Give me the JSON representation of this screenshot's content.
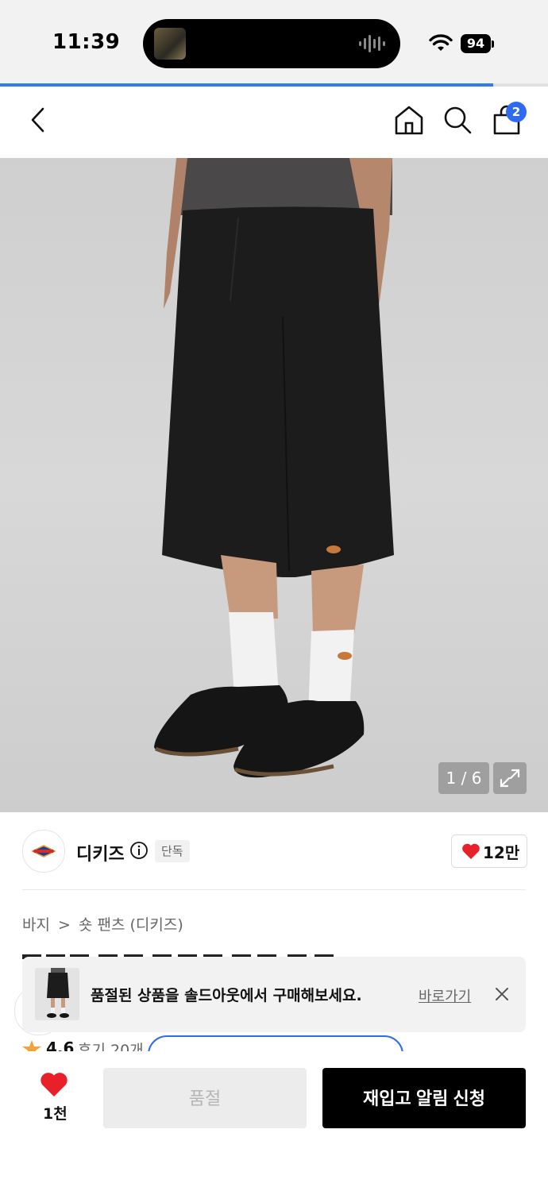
{
  "status_bar": {
    "time": "11:39",
    "battery": "94"
  },
  "page_progress": 0.9,
  "nav": {
    "back_icon": "chevron-left-icon",
    "home_icon": "home-icon",
    "search_icon": "search-icon",
    "cart_icon": "bag-icon",
    "cart_count": "2"
  },
  "gallery": {
    "counter": "1 / 6",
    "expand_icon": "expand-icon"
  },
  "brand": {
    "name": "디키즈",
    "badge": "단독",
    "like_count": "12만"
  },
  "breadcrumb": {
    "category": "바지",
    "separator": ">",
    "subcategory": "숏 팬츠 (디키즈)"
  },
  "toast": {
    "message": "품절된 상품을 솔드아웃에서 구매해보세요.",
    "link_label": "바로가기"
  },
  "rating": {
    "score": "4.6",
    "reviews": "후기 20개"
  },
  "bottom_bar": {
    "wish_count": "1천",
    "soldout_label": "품절",
    "restock_label": "재입고 알림 신청"
  },
  "colors": {
    "accent": "#2f6bf0",
    "heart": "#e8202a",
    "cta": "#000000"
  }
}
